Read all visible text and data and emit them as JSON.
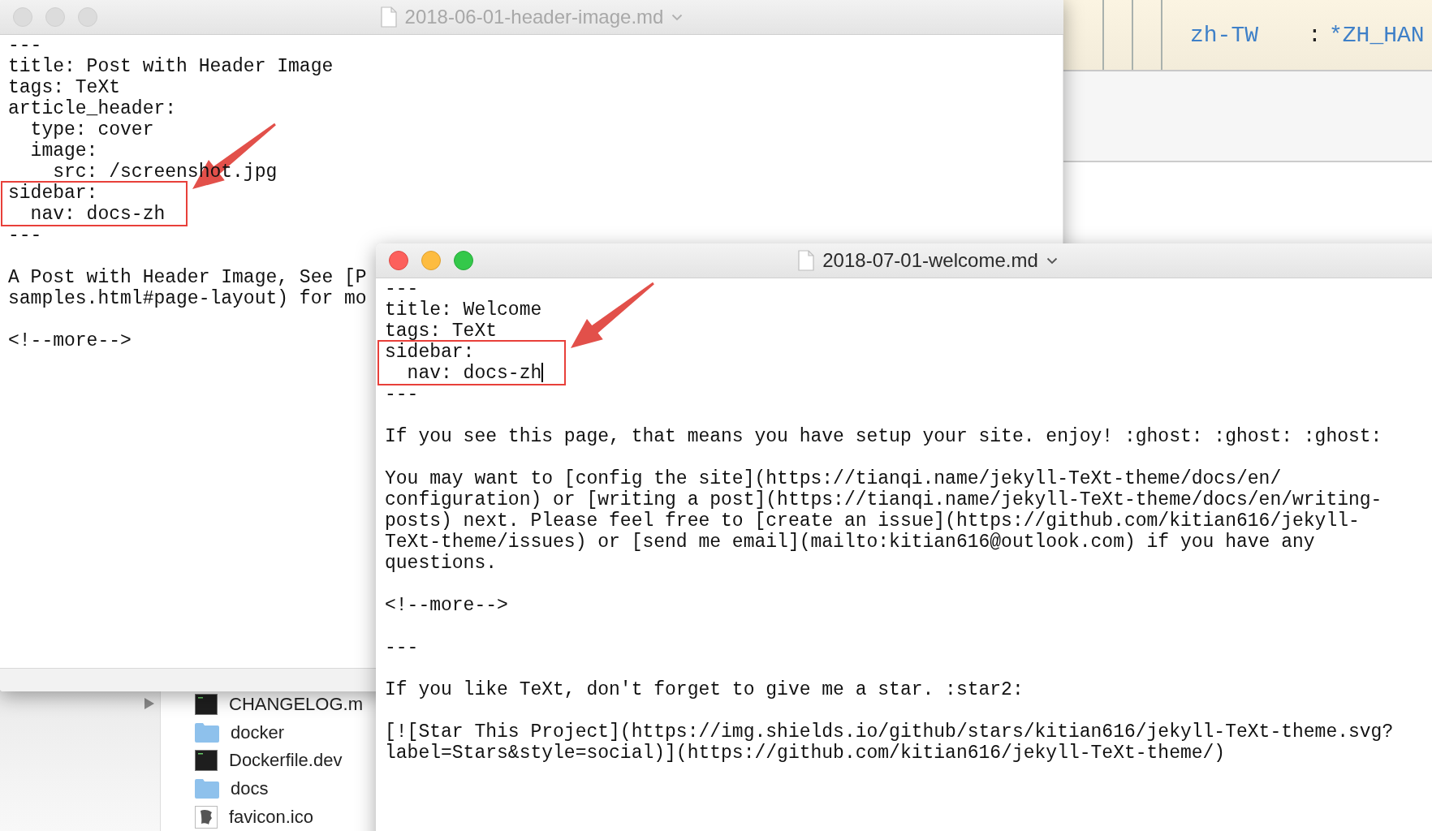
{
  "background_window": {
    "code_lines": [
      {
        "key": "zh-TW",
        "colon": ":",
        "value": "*ZH_HAN"
      }
    ]
  },
  "finder": {
    "rows": [
      {
        "name": "CHANGELOG.m",
        "kind": "document"
      },
      {
        "name": "docker",
        "kind": "folder"
      },
      {
        "name": "Dockerfile.dev",
        "kind": "document"
      },
      {
        "name": "docs",
        "kind": "folder"
      },
      {
        "name": "favicon.ico",
        "kind": "image"
      }
    ]
  },
  "windows": [
    {
      "title": "2018-06-01-header-image.md",
      "focused": false,
      "blocks": [
        {
          "kind": "front_matter",
          "head": [
            "---",
            "title: Post with Header Image",
            "tags: TeXt",
            "article_header:",
            "  type: cover",
            "  image:",
            "    src: /screenshot.jpg"
          ],
          "highlight": [
            "sidebar:",
            "  nav: docs-zh"
          ],
          "tail": [
            "---"
          ]
        },
        {
          "kind": "paragraph",
          "lines": [
            "A Post with Header Image, See [P",
            "samples.html#page-layout) for mo"
          ]
        },
        {
          "kind": "paragraph",
          "lines": [
            "<!--more-->"
          ]
        }
      ]
    },
    {
      "title": "2018-07-01-welcome.md",
      "focused": true,
      "blocks": [
        {
          "kind": "front_matter",
          "head": [
            "---",
            "title: Welcome",
            "tags: TeXt"
          ],
          "highlight": [
            "sidebar:",
            "  nav: docs-zh"
          ],
          "tail": [
            "---"
          ]
        },
        {
          "kind": "paragraph",
          "lines": [
            "If you see this page, that means you have setup your site. enjoy! :ghost: :ghost: :ghost:"
          ]
        },
        {
          "kind": "paragraph",
          "lines": [
            "You may want to [config the site](https://tianqi.name/jekyll-TeXt-theme/docs/en/",
            "configuration) or [writing a post](https://tianqi.name/jekyll-TeXt-theme/docs/en/writing-",
            "posts) next. Please feel free to [create an issue](https://github.com/kitian616/jekyll-",
            "TeXt-theme/issues) or [send me email](mailto:kitian616@outlook.com) if you have any",
            "questions."
          ]
        },
        {
          "kind": "paragraph",
          "lines": [
            "<!--more-->"
          ]
        },
        {
          "kind": "paragraph",
          "lines": [
            "---"
          ]
        },
        {
          "kind": "paragraph",
          "lines": [
            "If you like TeXt, don't forget to give me a star. :star2:"
          ]
        },
        {
          "kind": "paragraph",
          "lines": [
            "[![Star This Project](https://img.shields.io/github/stars/kitian616/jekyll-TeXt-theme.svg?",
            "label=Stars&style=social)](https://github.com/kitian616/jekyll-TeXt-theme/)"
          ]
        }
      ]
    }
  ]
}
